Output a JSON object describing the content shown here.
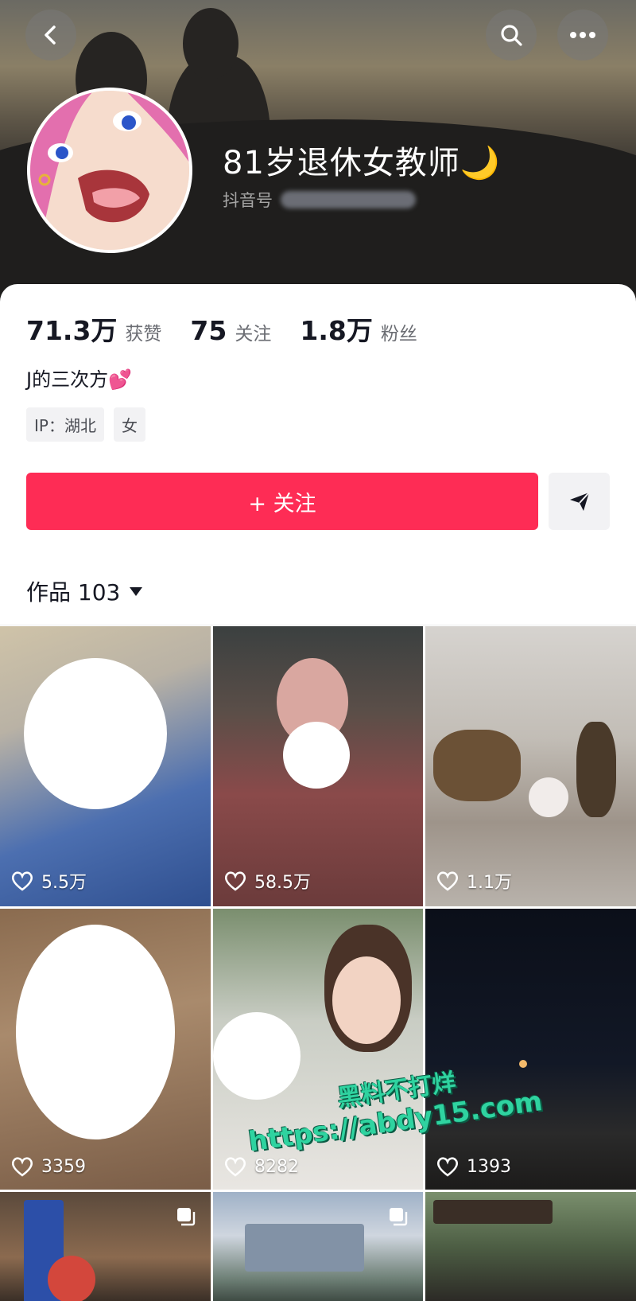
{
  "header": {
    "username": "81岁退休女教师🌙",
    "douyin_id_label": "抖音号"
  },
  "stats": [
    {
      "value": "71.3万",
      "label": "获赞"
    },
    {
      "value": "75",
      "label": "关注"
    },
    {
      "value": "1.8万",
      "label": "粉丝"
    }
  ],
  "bio": "J的三次方💕",
  "tags": [
    "IP：湖北",
    "女"
  ],
  "actions": {
    "follow_label": "+ 关注"
  },
  "works": {
    "label": "作品 103"
  },
  "videos": [
    {
      "likes": "5.5万"
    },
    {
      "likes": "58.5万"
    },
    {
      "likes": "1.1万"
    },
    {
      "likes": "3359"
    },
    {
      "likes": "8282"
    },
    {
      "likes": "1393"
    }
  ],
  "watermark": {
    "line1": "黑料不打烊",
    "line2": "https://abdy15.com"
  },
  "colors": {
    "accent": "#fe2c55",
    "watermark": "#2fd3a0"
  }
}
